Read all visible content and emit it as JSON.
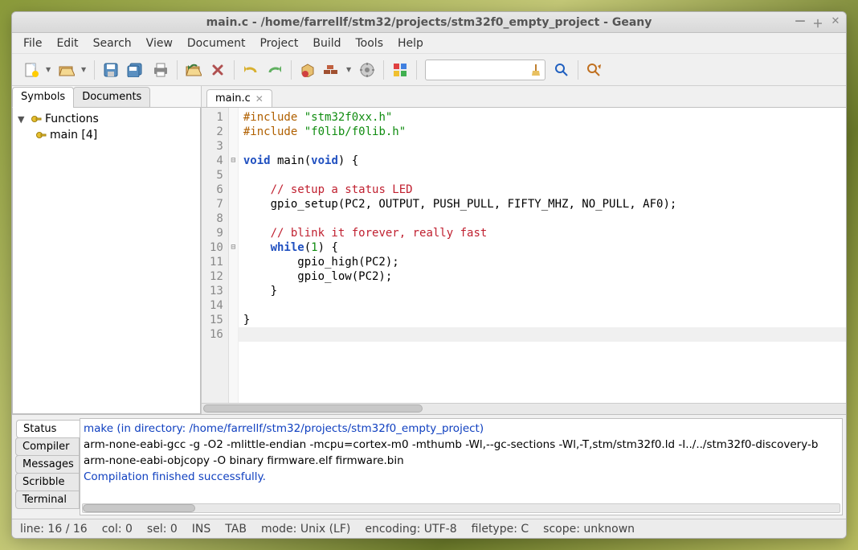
{
  "window": {
    "title": "main.c - /home/farrellf/stm32/projects/stm32f0_empty_project - Geany"
  },
  "menu": {
    "items": [
      "File",
      "Edit",
      "Search",
      "View",
      "Document",
      "Project",
      "Build",
      "Tools",
      "Help"
    ]
  },
  "sidebar": {
    "tabs": {
      "symbols": "Symbols",
      "documents": "Documents"
    },
    "functions_label": "Functions",
    "items": [
      {
        "label": "main [4]"
      }
    ]
  },
  "editor": {
    "tab_label": "main.c",
    "line_count": 16,
    "fold_markers": {
      "4": "⊟",
      "10": "⊟"
    },
    "code": [
      {
        "segments": [
          {
            "cls": "pp",
            "t": "#include"
          },
          {
            "cls": "",
            "t": " "
          },
          {
            "cls": "str",
            "t": "\"stm32f0xx.h\""
          }
        ]
      },
      {
        "segments": [
          {
            "cls": "pp",
            "t": "#include"
          },
          {
            "cls": "",
            "t": " "
          },
          {
            "cls": "str",
            "t": "\"f0lib/f0lib.h\""
          }
        ]
      },
      {
        "segments": []
      },
      {
        "segments": [
          {
            "cls": "kw",
            "t": "void"
          },
          {
            "cls": "",
            "t": " main("
          },
          {
            "cls": "kw",
            "t": "void"
          },
          {
            "cls": "",
            "t": ") {"
          }
        ]
      },
      {
        "segments": []
      },
      {
        "segments": [
          {
            "cls": "",
            "t": "    "
          },
          {
            "cls": "com",
            "t": "// setup a status LED"
          }
        ]
      },
      {
        "segments": [
          {
            "cls": "",
            "t": "    gpio_setup(PC2, OUTPUT, PUSH_PULL, FIFTY_MHZ, NO_PULL, AF0);"
          }
        ]
      },
      {
        "segments": []
      },
      {
        "segments": [
          {
            "cls": "",
            "t": "    "
          },
          {
            "cls": "com",
            "t": "// blink it forever, really fast"
          }
        ]
      },
      {
        "segments": [
          {
            "cls": "",
            "t": "    "
          },
          {
            "cls": "kw",
            "t": "while"
          },
          {
            "cls": "",
            "t": "("
          },
          {
            "cls": "str",
            "t": "1"
          },
          {
            "cls": "",
            "t": ") {"
          }
        ]
      },
      {
        "segments": [
          {
            "cls": "",
            "t": "        gpio_high(PC2);"
          }
        ]
      },
      {
        "segments": [
          {
            "cls": "",
            "t": "        gpio_low(PC2);"
          }
        ]
      },
      {
        "segments": [
          {
            "cls": "",
            "t": "    }"
          }
        ]
      },
      {
        "segments": []
      },
      {
        "segments": [
          {
            "cls": "",
            "t": "}"
          }
        ]
      },
      {
        "segments": []
      }
    ],
    "highlight_line": 16
  },
  "bottom": {
    "tabs": [
      "Status",
      "Compiler",
      "Messages",
      "Scribble",
      "Terminal"
    ],
    "active_tab": 0,
    "lines": [
      {
        "cls": "blue",
        "t": "make (in directory: /home/farrellf/stm32/projects/stm32f0_empty_project)"
      },
      {
        "cls": "",
        "t": "arm-none-eabi-gcc -g -O2 -mlittle-endian -mcpu=cortex-m0  -mthumb  -Wl,--gc-sections -Wl,-T,stm/stm32f0.ld -I../../stm32f0-discovery-b"
      },
      {
        "cls": "",
        "t": "arm-none-eabi-objcopy -O binary firmware.elf firmware.bin"
      },
      {
        "cls": "blue",
        "t": "Compilation finished successfully."
      }
    ]
  },
  "status": {
    "line": "line: 16 / 16",
    "col": "col: 0",
    "sel": "sel: 0",
    "ins": "INS",
    "tab": "TAB",
    "mode": "mode: Unix (LF)",
    "encoding": "encoding: UTF-8",
    "filetype": "filetype: C",
    "scope": "scope: unknown"
  }
}
